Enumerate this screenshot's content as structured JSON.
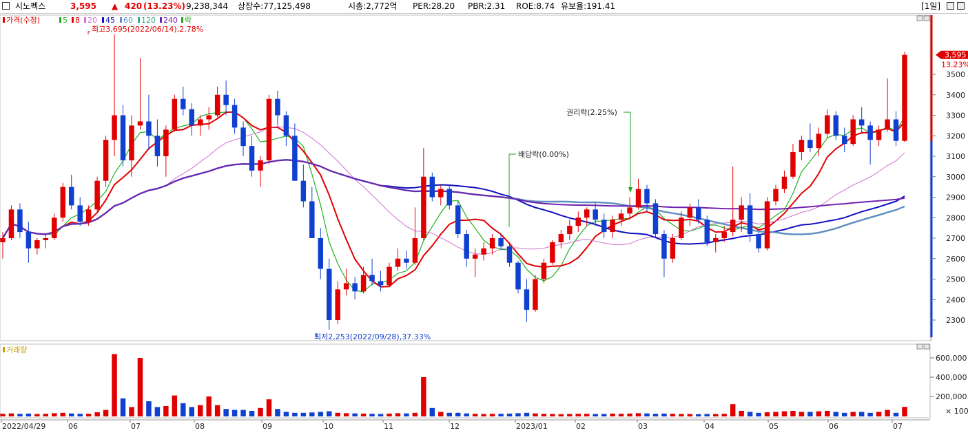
{
  "header": {
    "name": "시노펙스",
    "price": "3,595",
    "arrow": "▲",
    "change": "420",
    "change_pct": "(13.23%)",
    "volume": "9,238,344",
    "listed_shares": "상장수:77,125,498",
    "market_cap": "시총:2,772억",
    "per": "PER:28.20",
    "pbr": "PBR:2.31",
    "roe": "ROE:8.74",
    "reserve_ratio": "유보율:191.41",
    "period": "[1일]"
  },
  "legend": {
    "price_label": "가격(수정)",
    "ma": [
      "5",
      "8",
      "20",
      "45",
      "60",
      "120",
      "240"
    ],
    "ex_mark": "락",
    "volume_label": "거래량"
  },
  "annotations": {
    "high": "최고3,695(2022/06/14),2.78%",
    "low": "최저2,253(2022/09/28),37.33%",
    "dividend": "배당락(0.00%)",
    "rights": "권리락(2.25%)"
  },
  "last_price_tag": "3,595",
  "last_pct_tag": "13.23%",
  "volume_unit": "× 100",
  "colors": {
    "up": "#e00000",
    "down": "#1040d0",
    "ma5": "#20b020",
    "ma8": "#e00000",
    "ma20": "#d070d0",
    "ma45": "#1010c0",
    "ma60": "#6090c0",
    "ma120": "#30b080",
    "ma240": "#7020b0"
  },
  "chart_data": {
    "type": "line",
    "x_ticks": [
      "2022/04/29",
      "06",
      "07",
      "08",
      "09",
      "10",
      "11",
      "12",
      "2023/01",
      "02",
      "03",
      "04",
      "05",
      "06",
      "07"
    ],
    "price_axis_ticks": [
      2300,
      2400,
      2500,
      2600,
      2700,
      2800,
      2900,
      3000,
      3100,
      3200,
      3300,
      3400,
      3500
    ],
    "volume_axis_ticks": [
      "200,000",
      "400,000",
      "600,000"
    ],
    "ylim_price": [
      2200,
      3700
    ],
    "ylim_volume_x100": [
      0,
      700000
    ],
    "series": [
      {
        "name": "가격(수정)",
        "values": [
          [
            2680,
            2730,
            2600,
            2700
          ],
          [
            2700,
            2860,
            2690,
            2840
          ],
          [
            2840,
            2870,
            2700,
            2730
          ],
          [
            2730,
            2780,
            2580,
            2650
          ],
          [
            2650,
            2700,
            2620,
            2690
          ],
          [
            2690,
            2720,
            2650,
            2700
          ],
          [
            2700,
            2820,
            2690,
            2800
          ],
          [
            2800,
            2970,
            2780,
            2950
          ],
          [
            2950,
            3010,
            2840,
            2860
          ],
          [
            2860,
            2900,
            2760,
            2780
          ],
          [
            2780,
            2860,
            2760,
            2840
          ],
          [
            2840,
            3000,
            2830,
            2980
          ],
          [
            2980,
            3200,
            2950,
            3180
          ],
          [
            3180,
            3695,
            3100,
            3300
          ],
          [
            3300,
            3350,
            3050,
            3080
          ],
          [
            3080,
            3300,
            3000,
            3250
          ],
          [
            3250,
            3580,
            3230,
            3270
          ],
          [
            3270,
            3400,
            3130,
            3200
          ],
          [
            3200,
            3280,
            3050,
            3100
          ],
          [
            3100,
            3250,
            3000,
            3230
          ],
          [
            3230,
            3400,
            3220,
            3380
          ],
          [
            3380,
            3440,
            3300,
            3330
          ],
          [
            3330,
            3360,
            3200,
            3250
          ],
          [
            3250,
            3300,
            3200,
            3280
          ],
          [
            3280,
            3340,
            3230,
            3300
          ],
          [
            3300,
            3440,
            3290,
            3400
          ],
          [
            3400,
            3470,
            3300,
            3350
          ],
          [
            3350,
            3380,
            3210,
            3240
          ],
          [
            3240,
            3270,
            3100,
            3150
          ],
          [
            3150,
            3200,
            3000,
            3030
          ],
          [
            3030,
            3100,
            2950,
            3080
          ],
          [
            3080,
            3400,
            3060,
            3380
          ],
          [
            3380,
            3420,
            3250,
            3300
          ],
          [
            3300,
            3320,
            3150,
            3200
          ],
          [
            3200,
            3260,
            3000,
            2980
          ],
          [
            2980,
            3060,
            2850,
            2880
          ],
          [
            2880,
            2950,
            2700,
            2700
          ],
          [
            2700,
            2750,
            2500,
            2550
          ],
          [
            2550,
            2600,
            2253,
            2300
          ],
          [
            2300,
            2490,
            2280,
            2450
          ],
          [
            2450,
            2550,
            2420,
            2480
          ],
          [
            2480,
            2510,
            2400,
            2440
          ],
          [
            2440,
            2560,
            2430,
            2520
          ],
          [
            2520,
            2600,
            2470,
            2490
          ],
          [
            2490,
            2540,
            2440,
            2470
          ],
          [
            2470,
            2580,
            2460,
            2560
          ],
          [
            2560,
            2650,
            2540,
            2600
          ],
          [
            2600,
            2640,
            2550,
            2580
          ],
          [
            2580,
            2850,
            2570,
            2700
          ],
          [
            2700,
            3140,
            2690,
            3000
          ],
          [
            3000,
            3020,
            2880,
            2900
          ],
          [
            2900,
            2960,
            2860,
            2940
          ],
          [
            2940,
            2960,
            2840,
            2860
          ],
          [
            2860,
            2880,
            2700,
            2720
          ],
          [
            2720,
            2740,
            2560,
            2600
          ],
          [
            2600,
            2650,
            2510,
            2620
          ],
          [
            2620,
            2680,
            2590,
            2650
          ],
          [
            2650,
            2720,
            2620,
            2700
          ],
          [
            2700,
            2720,
            2640,
            2660
          ],
          [
            2660,
            2680,
            2560,
            2580
          ],
          [
            2580,
            2590,
            2430,
            2450
          ],
          [
            2450,
            2500,
            2290,
            2350
          ],
          [
            2350,
            2520,
            2340,
            2500
          ],
          [
            2500,
            2600,
            2480,
            2580
          ],
          [
            2580,
            2690,
            2570,
            2680
          ],
          [
            2680,
            2740,
            2650,
            2720
          ],
          [
            2720,
            2790,
            2690,
            2760
          ],
          [
            2760,
            2830,
            2730,
            2800
          ],
          [
            2800,
            2850,
            2760,
            2840
          ],
          [
            2840,
            2870,
            2760,
            2790
          ],
          [
            2790,
            2820,
            2700,
            2730
          ],
          [
            2730,
            2810,
            2700,
            2790
          ],
          [
            2790,
            2840,
            2760,
            2820
          ],
          [
            2820,
            2900,
            2790,
            2850
          ],
          [
            2850,
            2990,
            2840,
            2940
          ],
          [
            2940,
            2960,
            2830,
            2870
          ],
          [
            2870,
            2890,
            2700,
            2720
          ],
          [
            2720,
            2740,
            2510,
            2600
          ],
          [
            2600,
            2720,
            2580,
            2700
          ],
          [
            2700,
            2830,
            2690,
            2800
          ],
          [
            2800,
            2870,
            2760,
            2850
          ],
          [
            2850,
            2890,
            2770,
            2790
          ],
          [
            2790,
            2810,
            2660,
            2680
          ],
          [
            2680,
            2720,
            2630,
            2700
          ],
          [
            2700,
            2760,
            2680,
            2730
          ],
          [
            2730,
            3050,
            2710,
            2790
          ],
          [
            2790,
            2900,
            2730,
            2860
          ],
          [
            2860,
            2920,
            2680,
            2720
          ],
          [
            2720,
            2730,
            2630,
            2650
          ],
          [
            2650,
            2900,
            2640,
            2880
          ],
          [
            2880,
            2960,
            2860,
            2940
          ],
          [
            2940,
            3030,
            2920,
            3000
          ],
          [
            3000,
            3160,
            2990,
            3120
          ],
          [
            3120,
            3200,
            3080,
            3180
          ],
          [
            3180,
            3260,
            3120,
            3140
          ],
          [
            3140,
            3240,
            3100,
            3210
          ],
          [
            3210,
            3330,
            3190,
            3300
          ],
          [
            3300,
            3320,
            3180,
            3200
          ],
          [
            3200,
            3240,
            3120,
            3160
          ],
          [
            3160,
            3300,
            3150,
            3280
          ],
          [
            3280,
            3340,
            3210,
            3250
          ],
          [
            3250,
            3270,
            3060,
            3180
          ],
          [
            3180,
            3250,
            3150,
            3230
          ],
          [
            3230,
            3480,
            3220,
            3280
          ],
          [
            3280,
            3320,
            3150,
            3175
          ],
          [
            3175,
            3610,
            3170,
            3595
          ]
        ]
      },
      {
        "name": "5",
        "values": []
      },
      {
        "name": "8",
        "values": []
      },
      {
        "name": "20",
        "values": []
      },
      {
        "name": "45",
        "values": []
      },
      {
        "name": "60",
        "values": []
      },
      {
        "name": "120",
        "values": []
      },
      {
        "name": "240",
        "values": []
      },
      {
        "name": "거래량",
        "values": [
          20000,
          24000,
          19000,
          22000,
          18000,
          20000,
          26000,
          30000,
          24000,
          20000,
          20000,
          36000,
          60000,
          640000,
          180000,
          90000,
          600000,
          150000,
          90000,
          100000,
          210000,
          130000,
          90000,
          110000,
          200000,
          110000,
          70000,
          60000,
          60000,
          50000,
          80000,
          170000,
          70000,
          40000,
          30000,
          30000,
          34000,
          40000,
          46000,
          30000,
          26000,
          24000,
          22000,
          20000,
          18000,
          22000,
          26000,
          24000,
          30000,
          400000,
          80000,
          40000,
          30000,
          30000,
          24000,
          20000,
          18000,
          20000,
          20000,
          22000,
          26000,
          30000,
          24000,
          20000,
          18000,
          16000,
          18000,
          20000,
          20000,
          18000,
          18000,
          22000,
          20000,
          22000,
          26000,
          24000,
          20000,
          22000,
          20000,
          18000,
          18000,
          16000,
          18000,
          18000,
          20000,
          120000,
          50000,
          40000,
          30000,
          36000,
          40000,
          46000,
          50000,
          40000,
          40000,
          46000,
          50000,
          40000,
          30000,
          40000,
          40000,
          30000,
          40000,
          60000,
          30000,
          92000
        ]
      }
    ]
  }
}
